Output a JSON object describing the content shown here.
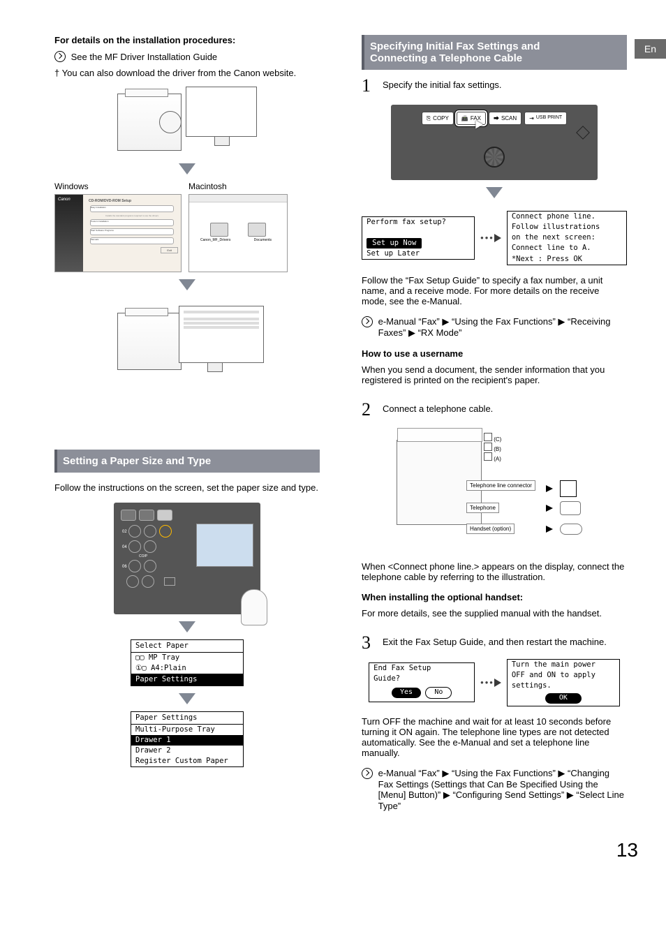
{
  "lang_tab": "En",
  "left": {
    "install_heading": "For details on the installation procedures:",
    "ref1": "See the MF Driver Installation Guide",
    "ref2_prefix": "†",
    "ref2": "You can also download the driver from the Canon website.",
    "os_windows": "Windows",
    "os_mac": "Macintosh",
    "win_title": "CD-ROM/DVD-ROM Setup",
    "win_b1": "Easy Installation",
    "win_b2": "Custom Installation",
    "win_b3": "Start Software Programs",
    "win_b4": "Manuals",
    "win_exit": "Exit",
    "mac_f1": "Canon_MF_Drivers",
    "mac_f2": "Documents",
    "section_paper": "Setting a Paper Size and Type",
    "paper_intro": "Follow the instructions on the screen, set the paper size and type.",
    "lcd1_hdr": "Select Paper",
    "lcd1_r1_icons": "▢▢",
    "lcd1_r1": "MP Tray",
    "lcd1_r2_icon": "①▢",
    "lcd1_r2": "A4:Plain",
    "lcd1_r3": "Paper Settings",
    "lcd2_hdr": "Paper Settings",
    "lcd2_r1": "Multi-Purpose Tray",
    "lcd2_r2": "Drawer 1",
    "lcd2_r3": "Drawer 2",
    "lcd2_r4": "Register Custom Paper"
  },
  "right": {
    "section_fax": "Specifying Initial Fax Settings and Connecting a Telephone Cable",
    "step1": "Specify the initial fax settings.",
    "btn_copy": "COPY",
    "btn_fax": "FAX",
    "btn_scan": "SCAN",
    "btn_usb": "USB PRINT",
    "lcdA_l1": "Perform fax setup?",
    "lcdA_l3": "Set up Now",
    "lcdA_l4": "Set up Later",
    "lcdB_l1": "Connect phone line.",
    "lcdB_l2": "Follow illustrations",
    "lcdB_l3": "on the next screen:",
    "lcdB_l4": "Connect line to A.",
    "lcdB_l5": "*Next : Press OK",
    "step1_para": "Follow the “Fax Setup Guide” to specify a fax number, a unit name, and a receive mode. For more details on the receive mode, see the e-Manual.",
    "ref_fax1": "e-Manual “Fax” ▶ “Using the Fax Functions” ▶ “Receiving Faxes” ▶ “RX Mode”",
    "how_heading": "How to use a username",
    "how_para": "When you send a document, the sender information that you registered is printed on the recipient's paper.",
    "step2": "Connect a telephone cable.",
    "lbl_C": "(C)",
    "lbl_B": "(B)",
    "lbl_A": "(A)",
    "lbl_connector": "Telephone line connector",
    "lbl_phone": "Telephone",
    "lbl_handset": "Handset (option)",
    "step2_para": "When <Connect phone line.> appears on the display, connect the telephone cable by referring to the illustration.",
    "when_heading": "When installing the optional handset:",
    "when_para": "For more details, see the supplied manual with the handset.",
    "step3": "Exit the Fax Setup Guide, and then restart the machine.",
    "lcdC_l1": "End Fax Setup",
    "lcdC_l2": "Guide?",
    "lcdC_yes": "Yes",
    "lcdC_no": "No",
    "lcdD_l1": "Turn the main power",
    "lcdD_l2": "OFF and ON to apply",
    "lcdD_l3": "settings.",
    "lcdD_ok": "OK",
    "step3_para": "Turn OFF the machine and wait for at least 10 seconds before turning it ON again. The telephone line types are not detected automatically. See the e-Manual and set a telephone line manually.",
    "ref_fax2": "e-Manual “Fax” ▶ “Using the Fax Functions” ▶ “Changing Fax Settings (Settings that Can Be Specified Using the [Menu] Button)” ▶ “Configuring Send Settings” ▶ “Select Line Type”"
  },
  "page_number": "13"
}
